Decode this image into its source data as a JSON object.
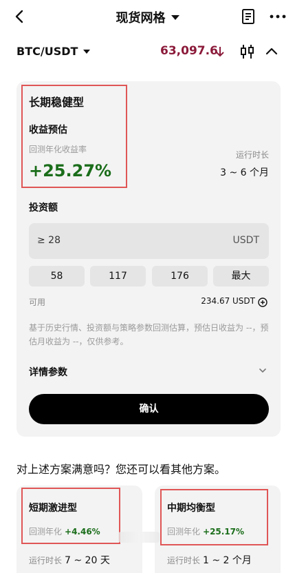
{
  "header": {
    "title": "现货网格"
  },
  "pair": {
    "symbol": "BTC/USDT",
    "price": "63,097.6"
  },
  "strategy": {
    "name": "长期稳健型",
    "yield_title": "收益预估",
    "yield_sub": "回测年化收益率",
    "yield_value": "+25.27%",
    "duration_label": "运行时长",
    "duration_value": "3 ~ 6 个月"
  },
  "invest": {
    "label": "投资额",
    "placeholder": "≥ 28",
    "unit": "USDT",
    "quick": [
      "58",
      "117",
      "176",
      "最大"
    ],
    "available_label": "可用",
    "available_value": "234.67 USDT"
  },
  "disclaimer": "基于历史行情、投资额与策略参数回测估算，预估日收益为 --，预估月收益为 --，仅供参考。",
  "details_label": "详情参数",
  "confirm_label": "确认",
  "prompt": "对上述方案满意吗？您还可以看其他方案。",
  "alternatives": [
    {
      "name": "短期激进型",
      "rate_label": "回测年化",
      "rate": "+4.46%",
      "duration_label": "运行时长",
      "duration": "7 ~ 20 天"
    },
    {
      "name": "中期均衡型",
      "rate_label": "回测年化",
      "rate": "+25.17%",
      "duration_label": "运行时长",
      "duration": "1 ~ 2 个月"
    }
  ],
  "colors": {
    "price": "#8b1a3a",
    "positive": "#1a6d1a",
    "highlight": "#e05555"
  }
}
